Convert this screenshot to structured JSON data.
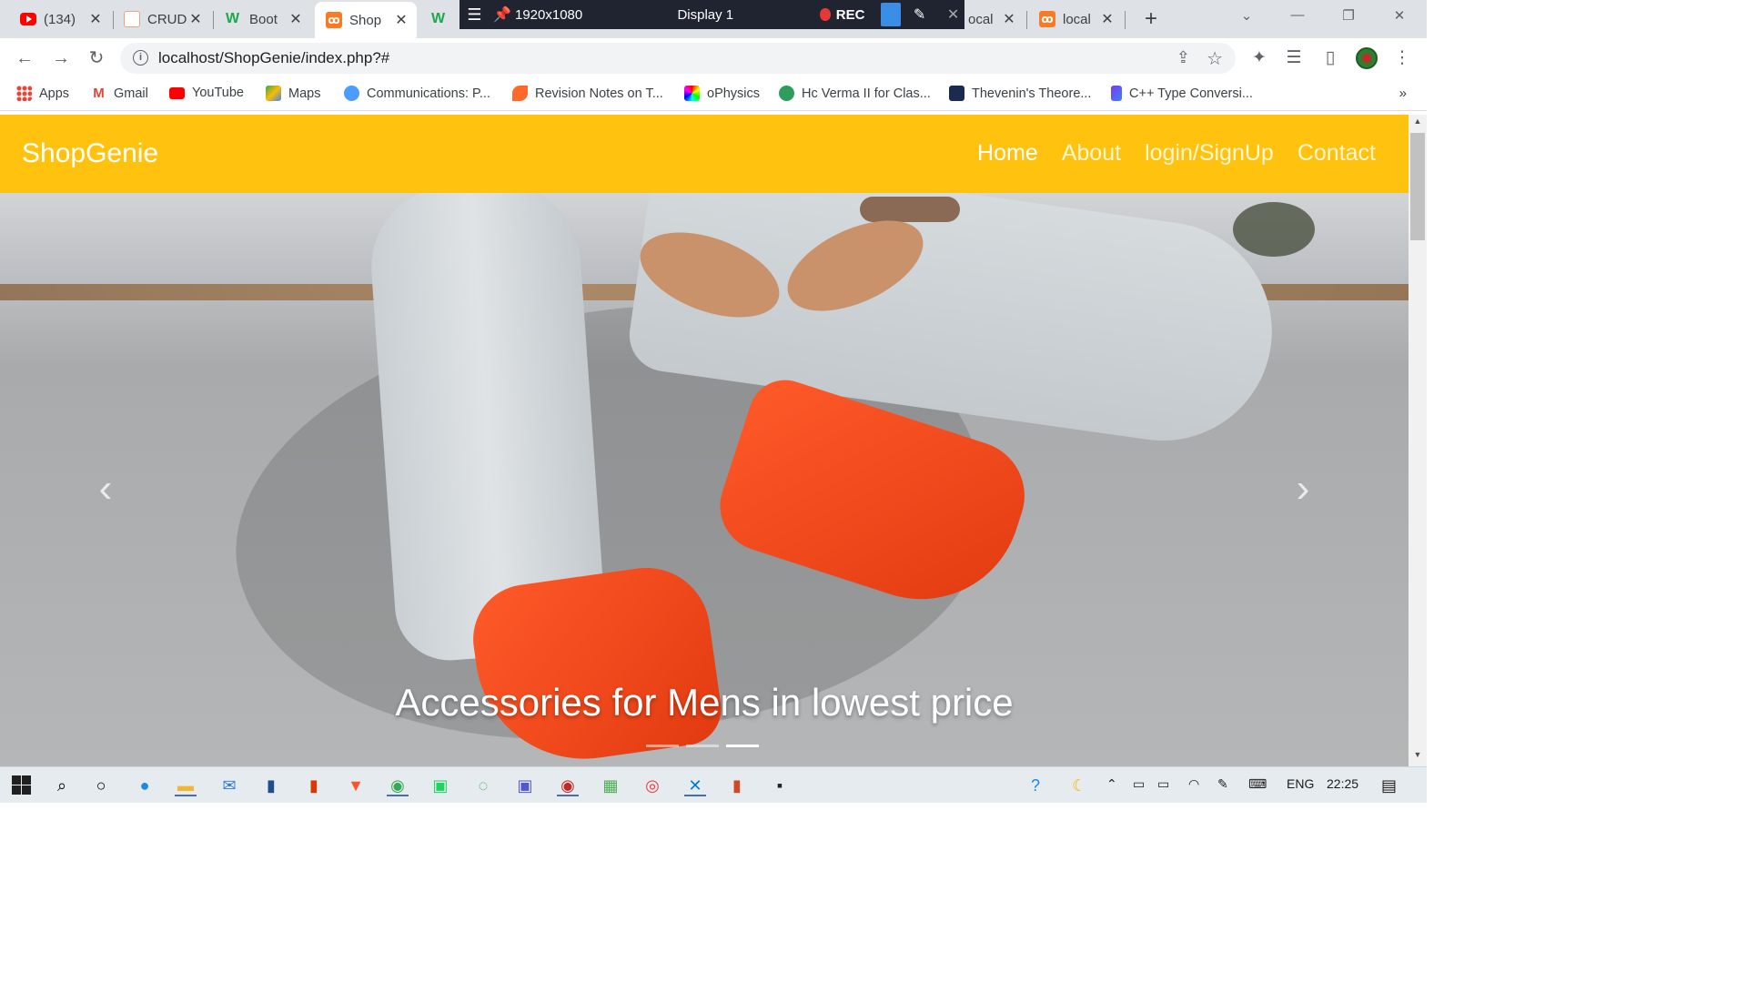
{
  "browser": {
    "tabs": [
      {
        "title": "(134)",
        "icon": "youtube-icon",
        "active": false
      },
      {
        "title": "CRUD",
        "icon": "crud-icon",
        "active": false
      },
      {
        "title": "Boot",
        "icon": "w3schools-icon",
        "active": false
      },
      {
        "title": "Shop",
        "icon": "xampp-icon",
        "active": true
      },
      {
        "title": "",
        "icon": "w3schools-icon",
        "active": false
      },
      {
        "title": "ocal",
        "icon": "",
        "active": false
      },
      {
        "title": "local",
        "icon": "xampp-icon",
        "active": false
      }
    ],
    "recorder": {
      "resolution": "1920x1080",
      "display": "Display 1",
      "rec_label": "REC"
    },
    "url": "localhost/ShopGenie/index.php?#",
    "bookmarks": [
      {
        "label": "Apps",
        "icon": "apps-grid-icon",
        "color": "#4285f4"
      },
      {
        "label": "Gmail",
        "icon": "gmail-icon",
        "color": "#ea4335"
      },
      {
        "label": "YouTube",
        "icon": "youtube-icon",
        "color": "#ff0000"
      },
      {
        "label": "Maps",
        "icon": "maps-icon",
        "color": "#34a853"
      },
      {
        "label": "Communications: P...",
        "icon": "upload-icon",
        "color": "#4a9cff"
      },
      {
        "label": "Revision Notes on T...",
        "icon": "revision-icon",
        "color": "#ff6a2a"
      },
      {
        "label": "oPhysics",
        "icon": "ophysics-icon",
        "color": "#222222"
      },
      {
        "label": "Hc Verma II for Clas...",
        "icon": "hcverma-icon",
        "color": "#2e9c5a"
      },
      {
        "label": "Thevenin's Theore...",
        "icon": "thevenin-icon",
        "color": "#1b2a50"
      },
      {
        "label": "C++ Type Conversi...",
        "icon": "cpp-icon",
        "color": "#7c3aed"
      }
    ]
  },
  "site": {
    "brand": "ShopGenie",
    "nav": [
      {
        "label": "Home",
        "active": true
      },
      {
        "label": "About",
        "active": false
      },
      {
        "label": "login/SignUp",
        "active": false
      },
      {
        "label": "Contact",
        "active": false
      }
    ],
    "nav_color": "#ffc20e",
    "carousel": {
      "caption": "Accessories for Mens in lowest price",
      "slide_count": 3,
      "active_slide": 3
    }
  },
  "taskbar": {
    "language": "ENG",
    "time": "22:25"
  }
}
